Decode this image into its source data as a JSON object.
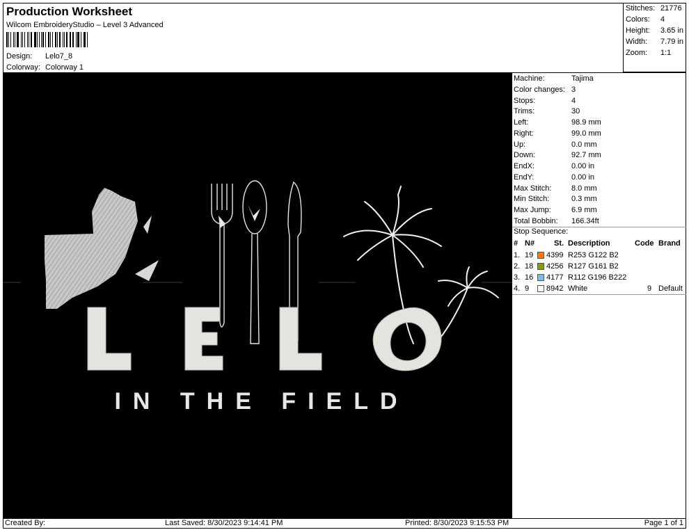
{
  "header": {
    "title": "Production Worksheet",
    "subtitle": "Wilcom EmbroideryStudio – Level 3 Advanced",
    "design_label": "Design:",
    "design_value": "Lelo7_8",
    "colorway_label": "Colorway:",
    "colorway_value": "Colorway 1"
  },
  "stats": {
    "stitches_label": "Stitches:",
    "stitches": "21776",
    "colors_label": "Colors:",
    "colors": "4",
    "height_label": "Height:",
    "height": "3.65 in",
    "width_label": "Width:",
    "width": "7.79 in",
    "zoom_label": "Zoom:",
    "zoom": "1:1"
  },
  "design": {
    "tagline": "IN THE FIELD",
    "letters": [
      "L",
      "E",
      "L",
      "O"
    ],
    "colors": {
      "orange": "#FD7A02",
      "green": "#7FA102",
      "blue": "#70C4DE",
      "white": "#E8E8E2",
      "background": "#000000"
    }
  },
  "info": {
    "machine_label": "Machine:",
    "machine": "Tajima",
    "color_changes_label": "Color changes:",
    "color_changes": "3",
    "stops_label": "Stops:",
    "stops": "4",
    "trims_label": "Trims:",
    "trims": "30",
    "left_label": "Left:",
    "left": "98.9 mm",
    "right_label": "Right:",
    "right": "99.0 mm",
    "up_label": "Up:",
    "up": "0.0 mm",
    "down_label": "Down:",
    "down": "92.7 mm",
    "endx_label": "EndX:",
    "endx": "0.00 in",
    "endy_label": "EndY:",
    "endy": "0.00 in",
    "max_stitch_label": "Max Stitch:",
    "max_stitch": "8.0 mm",
    "min_stitch_label": "Min Stitch:",
    "min_stitch": "0.3 mm",
    "max_jump_label": "Max Jump:",
    "max_jump": "6.9 mm",
    "total_bobbin_label": "Total Bobbin:",
    "total_bobbin": "166.34ft"
  },
  "stop_sequence": {
    "title": "Stop Sequence:",
    "headers": {
      "num": "#",
      "n": "N#",
      "st": "St.",
      "description": "Description",
      "code": "Code",
      "brand": "Brand"
    },
    "rows": [
      {
        "num": "1.",
        "n": "19",
        "st": "4399",
        "description": "R253 G122 B2",
        "code": "",
        "brand": "",
        "color": "#FD7A02"
      },
      {
        "num": "2.",
        "n": "18",
        "st": "4256",
        "description": "R127 G161 B2",
        "code": "",
        "brand": "",
        "color": "#7FA102"
      },
      {
        "num": "3.",
        "n": "16",
        "st": "4177",
        "description": "R112 G196 B222",
        "code": "",
        "brand": "",
        "color": "#70C4DE"
      },
      {
        "num": "4.",
        "n": "9",
        "st": "8942",
        "description": "White",
        "code": "9",
        "brand": "Default",
        "color": "#FFFFFF"
      }
    ]
  },
  "footer": {
    "created_by": "Created By:",
    "last_saved": "Last Saved: 8/30/2023 9:14:41 PM",
    "printed": "Printed: 8/30/2023 9:15:53 PM",
    "page": "Page 1 of 1"
  }
}
